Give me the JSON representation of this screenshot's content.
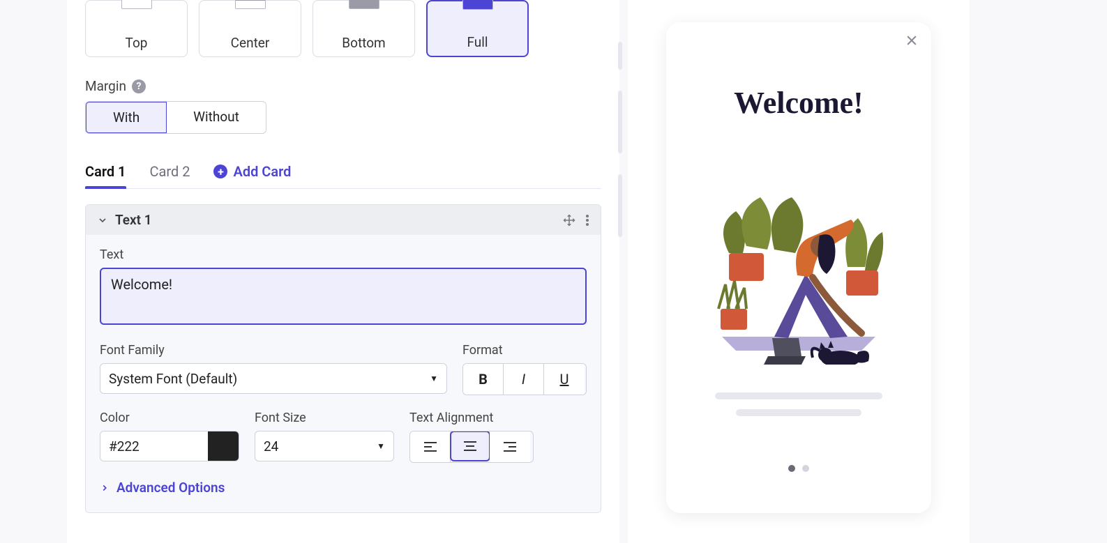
{
  "position": {
    "options": [
      "Top",
      "Center",
      "Bottom",
      "Full"
    ],
    "selected": "Full"
  },
  "margin": {
    "label": "Margin",
    "options": [
      "With",
      "Without"
    ],
    "selected": "With"
  },
  "cards": {
    "tabs": [
      "Card 1",
      "Card 2"
    ],
    "active": "Card 1",
    "add_label": "Add Card"
  },
  "text_block": {
    "header": "Text 1",
    "text_label": "Text",
    "text_value": "Welcome!",
    "font_family_label": "Font Family",
    "font_family_value": "System Font (Default)",
    "format_label": "Format",
    "color_label": "Color",
    "color_value": "#222",
    "font_size_label": "Font Size",
    "font_size_value": "24",
    "alignment_label": "Text Alignment",
    "alignment_selected": "center",
    "advanced_label": "Advanced Options"
  },
  "preview": {
    "title": "Welcome!",
    "dots_total": 2,
    "dots_active": 0
  }
}
